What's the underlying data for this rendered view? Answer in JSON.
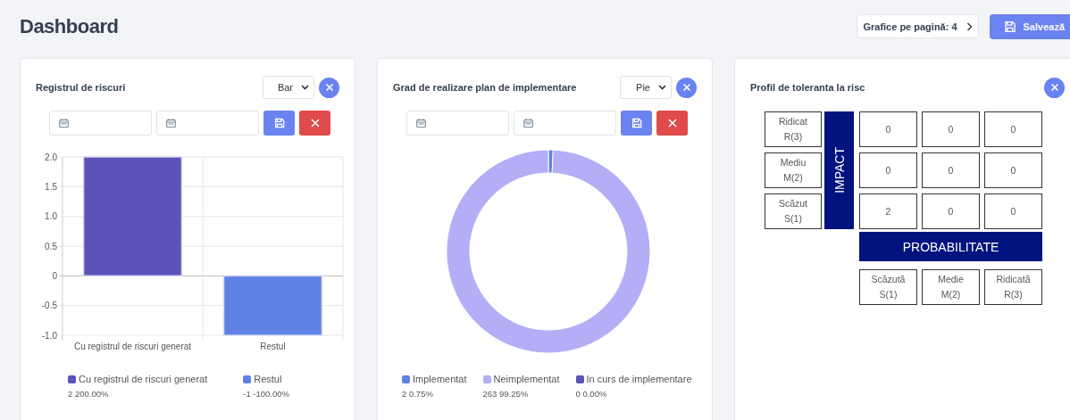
{
  "header": {
    "title": "Dashboard",
    "per_page_button": "Grafice pe pagină: 4",
    "save_button": "Salvează"
  },
  "cards": [
    {
      "title": "Registrul de riscuri",
      "chart_select": "Bar",
      "chart_data": {
        "type": "bar",
        "grid": true,
        "categories": [
          "Cu registrul de riscuri generat",
          "Restul"
        ],
        "values": [
          2,
          -1
        ],
        "ylim": [
          -1,
          2
        ],
        "yticks": [
          {
            "value": 2,
            "label": "2.0"
          },
          {
            "value": 1.5,
            "label": "1.5"
          },
          {
            "value": 1,
            "label": "1.0"
          },
          {
            "value": 0.5,
            "label": "0.5"
          },
          {
            "value": 0,
            "label": "0"
          },
          {
            "value": -0.5,
            "label": "-0.5"
          },
          {
            "value": -1,
            "label": "-1.0"
          }
        ]
      },
      "legend": [
        {
          "label": "Cu registrul de riscuri generat",
          "value": "2 200.00%",
          "color": "#5b53b8"
        },
        {
          "label": "Restul",
          "value": "-1 -100.00%",
          "color": "#5f82e6"
        }
      ]
    },
    {
      "title": "Grad de realizare plan de implementare",
      "chart_select": "Pie",
      "chart_data": {
        "type": "donut",
        "categories": [
          "Implementat",
          "Neimplementat",
          "In curs de implementare"
        ],
        "values": [
          0.75,
          99.25,
          0
        ]
      },
      "legend": [
        {
          "value": "2 0.75%",
          "color": "#5f82e6"
        },
        {
          "value": "263 99.25%",
          "color": "#b3aef5"
        },
        {
          "value": "0 0.00%",
          "color": "#5b53b8"
        }
      ]
    }
  ],
  "matrix": {
    "title": "Profil de toleranta la risc",
    "impact_label": "IMPACT",
    "rows": [
      {
        "label": "Ridicat",
        "code": "R(3)",
        "cells": [
          "0",
          "0",
          "0"
        ]
      },
      {
        "label": "Mediu",
        "code": "M(2)",
        "cells": [
          "0",
          "0",
          "0"
        ]
      },
      {
        "label": "Scăzut",
        "code": "S(1)",
        "cells": [
          "2",
          "0",
          "0"
        ]
      }
    ],
    "probability_label": "PROBABILITATE",
    "probability_levels": [
      {
        "label": "Scăzută",
        "code": "S(1)"
      },
      {
        "label": "Medie",
        "code": "M(2)"
      },
      {
        "label": "Ridicată",
        "code": "R(3)"
      }
    ]
  }
}
